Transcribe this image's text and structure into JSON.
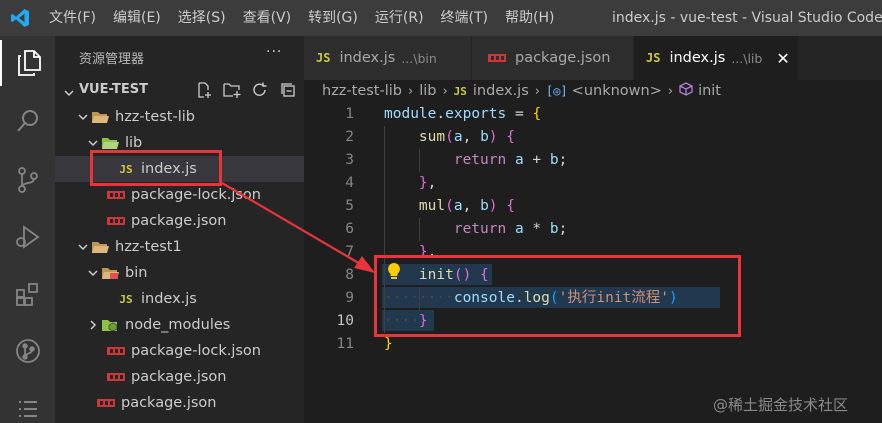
{
  "titlebar": {
    "menu": [
      "文件(F)",
      "编辑(E)",
      "选择(S)",
      "查看(V)",
      "转到(G)",
      "运行(R)",
      "终端(T)",
      "帮助(H)"
    ],
    "window_title": "index.js - vue-test - Visual Studio Code [管"
  },
  "activitybar": {
    "icons": [
      "explorer-icon",
      "search-icon",
      "source-control-icon",
      "run-debug-icon",
      "extensions-icon",
      "git-graph-icon",
      "list-icon"
    ]
  },
  "sidebar": {
    "title": "资源管理器",
    "more": "···",
    "section_label": "VUE-TEST",
    "tree": [
      {
        "label": "hzz-test-lib",
        "type": "folder",
        "expanded": true
      },
      {
        "label": "lib",
        "type": "folder",
        "expanded": true
      },
      {
        "label": "index.js",
        "type": "js",
        "selected": true,
        "js_badge": "JS"
      },
      {
        "label": "package-lock.json",
        "type": "json"
      },
      {
        "label": "package.json",
        "type": "json"
      },
      {
        "label": "hzz-test1",
        "type": "folder",
        "expanded": true
      },
      {
        "label": "bin",
        "type": "folder",
        "expanded": true
      },
      {
        "label": "index.js",
        "type": "js",
        "js_badge": "JS"
      },
      {
        "label": "node_modules",
        "type": "folder",
        "expanded": false
      },
      {
        "label": "package-lock.json",
        "type": "json"
      },
      {
        "label": "package.json",
        "type": "json"
      },
      {
        "label": "package.json",
        "type": "json"
      }
    ]
  },
  "tabs": [
    {
      "badge": "JS",
      "name": "index.js",
      "desc": "...\\bin",
      "active": false
    },
    {
      "badge": "",
      "name": "package.json",
      "desc": "",
      "active": false
    },
    {
      "badge": "JS",
      "name": "index.js",
      "desc": "...\\lib",
      "active": true,
      "close": "✕"
    }
  ],
  "breadcrumb": {
    "parts": [
      "hzz-test-lib",
      "lib"
    ],
    "file_badge": "JS",
    "file": "index.js",
    "unknown_badge": "[◎]",
    "unknown": "<unknown>",
    "symbol": "init",
    "separator": "›"
  },
  "editor": {
    "line_numbers": [
      "1",
      "2",
      "3",
      "4",
      "5",
      "6",
      "7",
      "8",
      "9",
      "10",
      "11"
    ],
    "current_line": "10",
    "lines": [
      [
        {
          "t": "module",
          "c": "tk-var"
        },
        {
          "t": ".",
          "c": "tk-op"
        },
        {
          "t": "exports",
          "c": "tk-var"
        },
        {
          "t": " = ",
          "c": "tk-op"
        },
        {
          "t": "{",
          "c": "tk-b1"
        }
      ],
      [
        {
          "t": "    ",
          "c": ""
        },
        {
          "t": "sum",
          "c": "tk-fn"
        },
        {
          "t": "(",
          "c": "tk-b2"
        },
        {
          "t": "a",
          "c": "tk-var"
        },
        {
          "t": ", ",
          "c": "tk-op"
        },
        {
          "t": "b",
          "c": "tk-var"
        },
        {
          "t": ")",
          "c": "tk-b2"
        },
        {
          "t": " ",
          "c": ""
        },
        {
          "t": "{",
          "c": "tk-b2"
        }
      ],
      [
        {
          "t": "        ",
          "c": ""
        },
        {
          "t": "return",
          "c": "tk-kw"
        },
        {
          "t": " ",
          "c": ""
        },
        {
          "t": "a",
          "c": "tk-var"
        },
        {
          "t": " + ",
          "c": "tk-op"
        },
        {
          "t": "b",
          "c": "tk-var"
        },
        {
          "t": ";",
          "c": "tk-op"
        }
      ],
      [
        {
          "t": "    ",
          "c": ""
        },
        {
          "t": "}",
          "c": "tk-b2"
        },
        {
          "t": ",",
          "c": "tk-op"
        }
      ],
      [
        {
          "t": "    ",
          "c": ""
        },
        {
          "t": "mul",
          "c": "tk-fn"
        },
        {
          "t": "(",
          "c": "tk-b2"
        },
        {
          "t": "a",
          "c": "tk-var"
        },
        {
          "t": ", ",
          "c": "tk-op"
        },
        {
          "t": "b",
          "c": "tk-var"
        },
        {
          "t": ")",
          "c": "tk-b2"
        },
        {
          "t": " ",
          "c": ""
        },
        {
          "t": "{",
          "c": "tk-b2"
        }
      ],
      [
        {
          "t": "        ",
          "c": ""
        },
        {
          "t": "return",
          "c": "tk-kw"
        },
        {
          "t": " ",
          "c": ""
        },
        {
          "t": "a",
          "c": "tk-var"
        },
        {
          "t": " * ",
          "c": "tk-op"
        },
        {
          "t": "b",
          "c": "tk-var"
        },
        {
          "t": ";",
          "c": "tk-op"
        }
      ],
      [
        {
          "t": "    ",
          "c": ""
        },
        {
          "t": "}",
          "c": "tk-b2"
        },
        {
          "t": ",",
          "c": "tk-op"
        }
      ],
      [
        {
          "t": "    ",
          "c": ""
        },
        {
          "t": "init",
          "c": "tk-fn"
        },
        {
          "t": "()",
          "c": "tk-b2"
        },
        {
          "t": " ",
          "c": ""
        },
        {
          "t": "{",
          "c": "tk-b2"
        }
      ],
      [
        {
          "t": "········",
          "c": "ws"
        },
        {
          "t": "console",
          "c": "tk-var"
        },
        {
          "t": ".",
          "c": "tk-op"
        },
        {
          "t": "log",
          "c": "tk-fn"
        },
        {
          "t": "(",
          "c": "tk-b3"
        },
        {
          "t": "'执行init流程'",
          "c": "tk-str"
        },
        {
          "t": ")",
          "c": "tk-b3"
        }
      ],
      [
        {
          "t": "····",
          "c": "ws"
        },
        {
          "t": "}",
          "c": "tk-b2"
        }
      ],
      [
        {
          "t": "}",
          "c": "tk-b1"
        }
      ]
    ]
  },
  "colors": {
    "annotation_red": "#e8343a",
    "js_yellow": "#cbcb41",
    "accent_blue": "#23a9f2"
  },
  "watermark": "@稀土掘金技术社区"
}
